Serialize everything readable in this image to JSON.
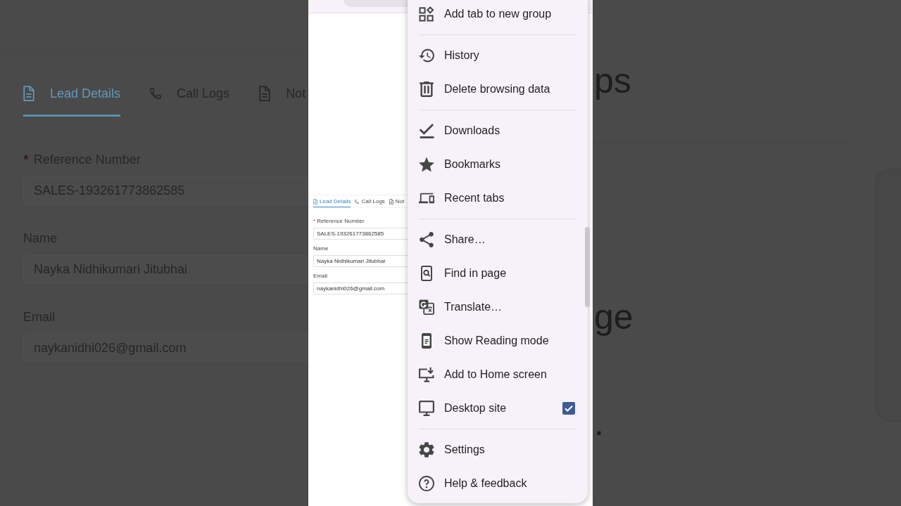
{
  "background_left": {
    "tabs": [
      {
        "label": "Lead Details",
        "selected": true
      },
      {
        "label": "Call Logs",
        "selected": false
      },
      {
        "label": "Not",
        "selected": false
      }
    ],
    "fields": [
      {
        "required_mark": "*",
        "label": "Reference Number",
        "value": "SALES-193261773862585"
      },
      {
        "label": "Name",
        "value": "Nayka Nidhikumari Jitubhai"
      },
      {
        "label": "Email",
        "value": "naykanidhi026@gmail.com"
      }
    ]
  },
  "phone": {
    "page": {
      "tabs": [
        {
          "label": "Lead Details",
          "selected": true
        },
        {
          "label": "Call Logs",
          "selected": false
        },
        {
          "label": "Not",
          "selected": false
        }
      ],
      "fields": [
        {
          "required_mark": "*",
          "label": "Reference Number",
          "value": "SALES-193261773862585"
        },
        {
          "label": "Name",
          "value": "Nayka Nidhikumari Jitubhai"
        },
        {
          "label": "Email",
          "value": "naykanidhi026@gmail.com"
        }
      ]
    },
    "menu": {
      "sections": [
        {
          "items": [
            {
              "label": "Add tab to new group",
              "kind": "action"
            }
          ]
        },
        {
          "items": [
            {
              "label": "History",
              "kind": "action"
            },
            {
              "label": "Delete browsing data",
              "kind": "action"
            }
          ]
        },
        {
          "items": [
            {
              "label": "Downloads",
              "kind": "action"
            },
            {
              "label": "Bookmarks",
              "kind": "action"
            },
            {
              "label": "Recent tabs",
              "kind": "action"
            }
          ]
        },
        {
          "items": [
            {
              "label": "Share…",
              "kind": "action"
            },
            {
              "label": "Find in page",
              "kind": "action"
            },
            {
              "label": "Translate…",
              "kind": "action"
            },
            {
              "label": "Show Reading mode",
              "kind": "action"
            },
            {
              "label": "Add to Home screen",
              "kind": "action"
            },
            {
              "label": "Desktop site",
              "kind": "checkbox",
              "checked": true
            }
          ]
        },
        {
          "items": [
            {
              "label": "Settings",
              "kind": "action"
            },
            {
              "label": "Help & feedback",
              "kind": "action"
            }
          ]
        }
      ]
    }
  },
  "background_right": {
    "fragments": [
      "ps",
      "ge",
      "."
    ]
  }
}
